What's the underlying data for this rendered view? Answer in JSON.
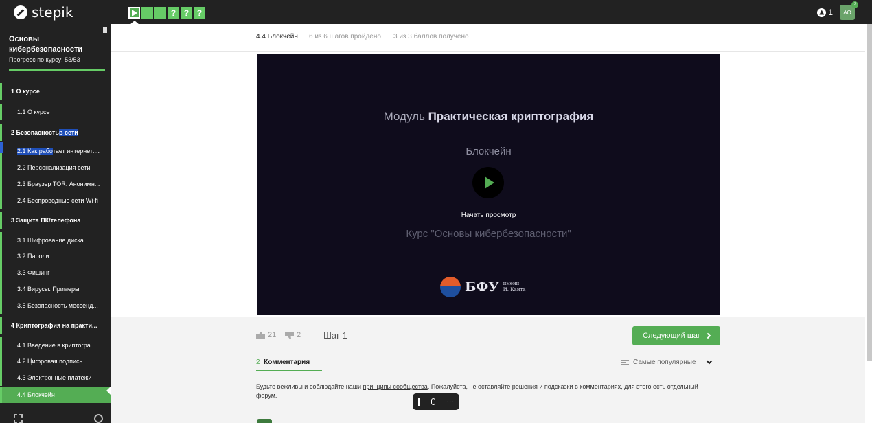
{
  "app": {
    "logo_text": "stepik"
  },
  "step_nav": [
    {
      "type": "video",
      "label": ""
    },
    {
      "type": "done",
      "label": ""
    },
    {
      "type": "done",
      "label": ""
    },
    {
      "type": "quiz",
      "label": "?"
    },
    {
      "type": "quiz",
      "label": "?"
    },
    {
      "type": "quiz",
      "label": "?"
    }
  ],
  "topbar": {
    "notifications_count": "1",
    "avatar_initials": "АО",
    "avatar_badge": "2"
  },
  "sidebar": {
    "course_title": "Основы кибербезопасности",
    "progress_label": "Прогресс по курсу:  53/53",
    "progress_fraction": 1.0,
    "items": [
      {
        "kind": "section",
        "label": "1  О курсе"
      },
      {
        "kind": "lesson",
        "label": "1.1  О курсе"
      },
      {
        "kind": "section",
        "label_pre": "2  Безопасность ",
        "label_hl": "в сети",
        "label_post": ""
      },
      {
        "kind": "lesson",
        "label_pre": "2.1  Как рабо",
        "label_hl": "",
        "label_post": "тает интернет:..."
      },
      {
        "kind": "lesson",
        "label": "2.2  Персонализация сети"
      },
      {
        "kind": "lesson",
        "label": "2.3  Браузер TOR. Анонимн..."
      },
      {
        "kind": "lesson",
        "label": "2.4  Беспроводные сети Wi-fi"
      },
      {
        "kind": "section",
        "label": "3  Защита ПК/телефона"
      },
      {
        "kind": "lesson",
        "label": "3.1  Шифрование диска"
      },
      {
        "kind": "lesson",
        "label": "3.2  Пароли"
      },
      {
        "kind": "lesson",
        "label": "3.3  Фишинг"
      },
      {
        "kind": "lesson",
        "label": "3.4  Вирусы. Примеры"
      },
      {
        "kind": "lesson",
        "label": "3.5  Безопасность мессенд..."
      },
      {
        "kind": "section",
        "label": "4  Криптография на практи..."
      },
      {
        "kind": "lesson",
        "label": "4.1  Введение в криптогра..."
      },
      {
        "kind": "lesson",
        "label": "4.2  Цифровая подпись"
      },
      {
        "kind": "lesson",
        "label": "4.3  Электронные платежи"
      },
      {
        "kind": "lesson",
        "label": "4.4  Блокчейн",
        "active": true
      }
    ]
  },
  "lesson": {
    "title": "4.4 Блокчейн",
    "steps_progress": "6 из 6 шагов пройдено",
    "score": "3 из 3 баллов  получено"
  },
  "video": {
    "module_prefix": "Модуль ",
    "module_name": "Практическая криптография",
    "subtitle": "Блокчейн",
    "start_label": "Начать просмотр",
    "course_line": "Курс \"Основы кибербезопасности\"",
    "logo_name": "БФУ",
    "logo_sub1": "имени",
    "logo_sub2": "И. Канта"
  },
  "controls": {
    "likes": "21",
    "dislikes": "2",
    "step_label": "Шаг 1",
    "next_label": "Следующий шаг"
  },
  "comments": {
    "count": "2",
    "tab_label": "Комментария",
    "sort_label": "Самые популярные",
    "rules_pre": "Будьте вежливы и соблюдайте наши ",
    "rules_link": "принципы сообщества",
    "rules_post": ". Пожалуйста, не оставляйте решения и подсказки в комментариях, для этого есть отдельный форум."
  },
  "colors": {
    "accent": "#54ad54",
    "sidebar_bg": "#222222",
    "video_bg": "#0f0c1c",
    "highlight": "#1f4fb8"
  }
}
